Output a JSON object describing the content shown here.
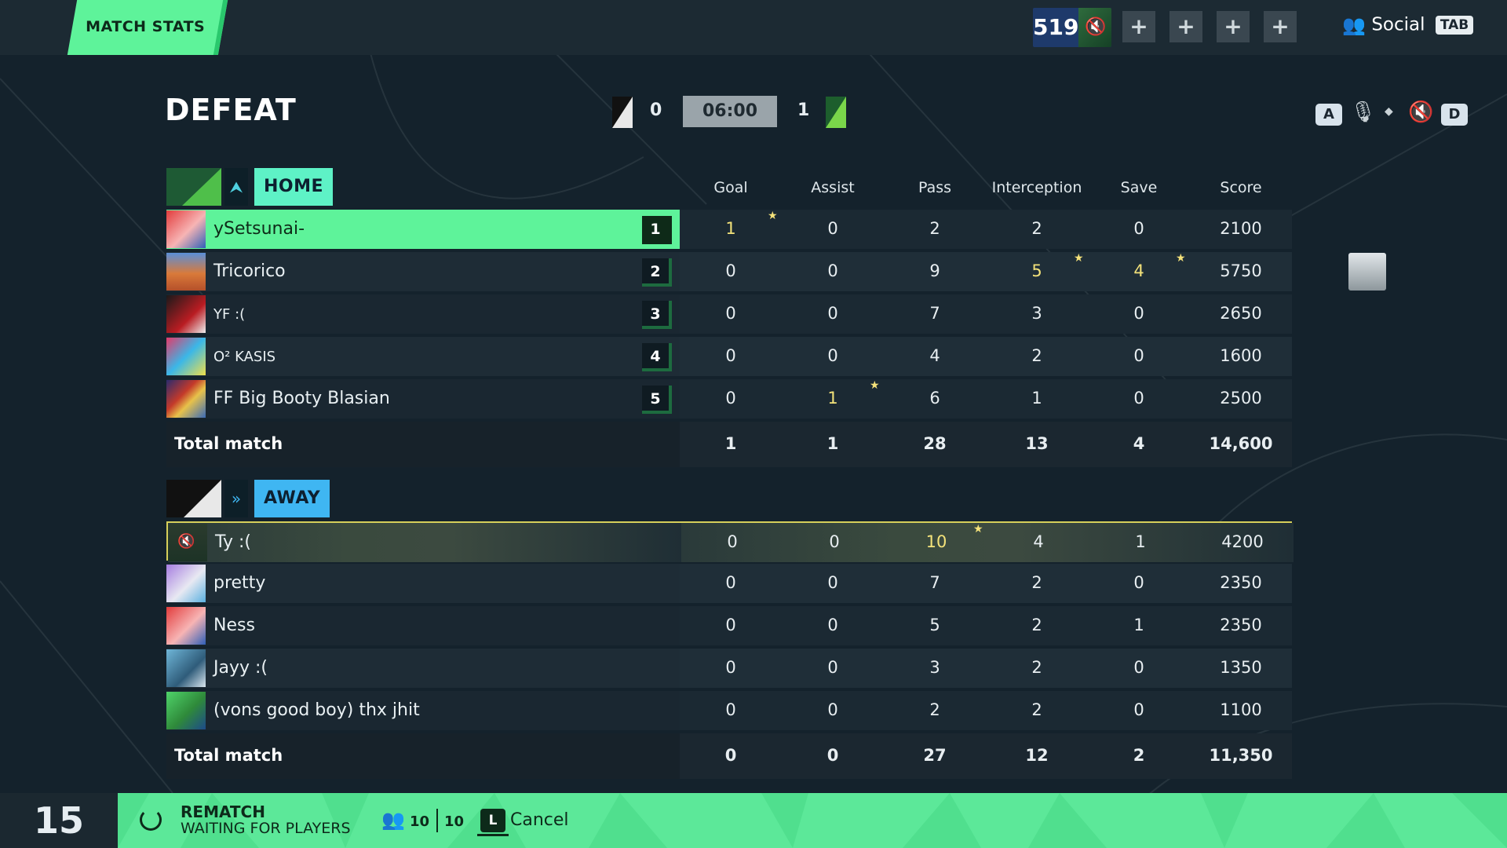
{
  "topbar": {
    "tab_label": "MATCH STATS",
    "coins": "519",
    "plus_label": "+",
    "social_label": "Social",
    "social_key": "TAB"
  },
  "header": {
    "result": "DEFEAT",
    "home_score": "0",
    "away_score": "1",
    "timer": "06:00",
    "key_a": "A",
    "key_d": "D"
  },
  "columns": [
    "Goal",
    "Assist",
    "Pass",
    "Interception",
    "Save",
    "Score"
  ],
  "home": {
    "name": "HOME",
    "players": [
      {
        "name": "ySetsunai-",
        "rank": "1",
        "stats": [
          "1",
          "0",
          "2",
          "2",
          "0",
          "2100"
        ]
      },
      {
        "name": "Tricorico",
        "rank": "2",
        "stats": [
          "0",
          "0",
          "9",
          "5",
          "4",
          "5750"
        ]
      },
      {
        "name": "YF :(",
        "rank": "3",
        "stats": [
          "0",
          "0",
          "7",
          "3",
          "0",
          "2650"
        ]
      },
      {
        "name": "O² KASIS",
        "rank": "4",
        "stats": [
          "0",
          "0",
          "4",
          "2",
          "0",
          "1600"
        ]
      },
      {
        "name": "FF Big Booty Blasian",
        "rank": "5",
        "stats": [
          "0",
          "1",
          "6",
          "1",
          "0",
          "2500"
        ]
      }
    ],
    "total_label": "Total match",
    "totals": [
      "1",
      "1",
      "28",
      "13",
      "4",
      "14,600"
    ]
  },
  "away": {
    "name": "AWAY",
    "players": [
      {
        "name": "Ty :(",
        "stats": [
          "0",
          "0",
          "10",
          "4",
          "1",
          "4200"
        ]
      },
      {
        "name": "pretty",
        "stats": [
          "0",
          "0",
          "7",
          "2",
          "0",
          "2350"
        ]
      },
      {
        "name": "Ness",
        "stats": [
          "0",
          "0",
          "5",
          "2",
          "1",
          "2350"
        ]
      },
      {
        "name": "Jayy :(",
        "stats": [
          "0",
          "0",
          "3",
          "2",
          "0",
          "1350"
        ]
      },
      {
        "name": "(vons good boy) thx jhit",
        "stats": [
          "0",
          "0",
          "2",
          "2",
          "0",
          "1100"
        ]
      }
    ],
    "total_label": "Total match",
    "totals": [
      "0",
      "0",
      "27",
      "12",
      "2",
      "11,350"
    ]
  },
  "bottom": {
    "countdown": "15",
    "rematch": "REMATCH",
    "waiting": "WAITING FOR PLAYERS",
    "ready": "10",
    "total": "10",
    "cancel_key": "L",
    "cancel_label": "Cancel"
  },
  "colors": {
    "accent_green": "#5ef39a",
    "away_blue": "#3fb6f2",
    "highlight_yellow": "#f3e27a"
  }
}
